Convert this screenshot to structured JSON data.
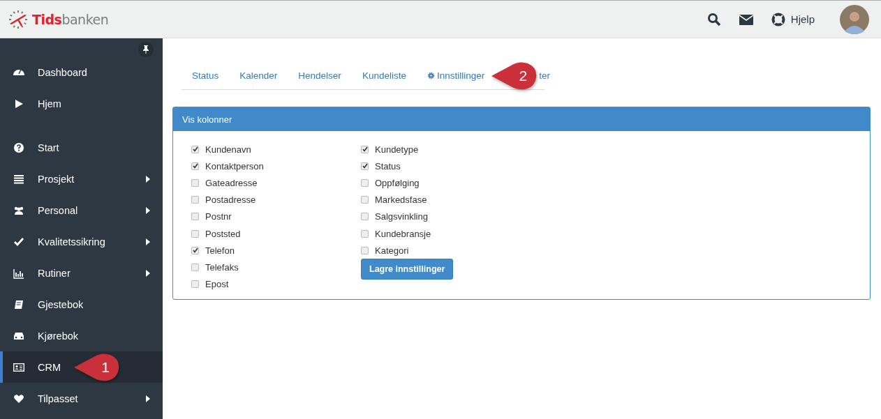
{
  "header": {
    "logo": {
      "part_1": "Tids",
      "part_2": "banken"
    },
    "help_label": "Hjelp"
  },
  "sidebar": {
    "sections": [
      {
        "items": [
          {
            "label": "Dashboard",
            "submenu": false,
            "selected": false
          },
          {
            "label": "Hjem",
            "submenu": false,
            "selected": false
          }
        ]
      },
      {
        "items": [
          {
            "label": "Start",
            "submenu": false,
            "selected": false
          },
          {
            "label": "Prosjekt",
            "submenu": true,
            "selected": false
          },
          {
            "label": "Personal",
            "submenu": true,
            "selected": false
          },
          {
            "label": "Kvalitetssikring",
            "submenu": true,
            "selected": false
          },
          {
            "label": "Rutiner",
            "submenu": true,
            "selected": false
          },
          {
            "label": "Gjestebok",
            "submenu": false,
            "selected": false
          },
          {
            "label": "Kjørebok",
            "submenu": false,
            "selected": false
          },
          {
            "label": "CRM",
            "submenu": false,
            "selected": true
          },
          {
            "label": "Tilpasset",
            "submenu": true,
            "selected": false
          }
        ]
      }
    ]
  },
  "tabs": [
    {
      "label": "Status",
      "gear": false
    },
    {
      "label": "Kalender",
      "gear": false
    },
    {
      "label": "Hendelser",
      "gear": false
    },
    {
      "label": "Kundeliste",
      "gear": false
    },
    {
      "label": "Innstillinger",
      "gear": true
    },
    {
      "label": "ter",
      "gear": false
    }
  ],
  "panel": {
    "title": "Vis kolonner",
    "columns": [
      [
        {
          "label": "Kundenavn",
          "checked": true
        },
        {
          "label": "Kontaktperson",
          "checked": true
        },
        {
          "label": "Gateadresse",
          "checked": false
        },
        {
          "label": "Postadresse",
          "checked": false
        },
        {
          "label": "Postnr",
          "checked": false
        },
        {
          "label": "Poststed",
          "checked": false
        },
        {
          "label": "Telefon",
          "checked": true
        },
        {
          "label": "Telefaks",
          "checked": false
        },
        {
          "label": "Epost",
          "checked": false
        }
      ],
      [
        {
          "label": "Kundetype",
          "checked": true
        },
        {
          "label": "Status",
          "checked": true
        },
        {
          "label": "Oppfølging",
          "checked": false
        },
        {
          "label": "Markedsfase",
          "checked": false
        },
        {
          "label": "Salgsvinkling",
          "checked": false
        },
        {
          "label": "Kundebransje",
          "checked": false
        },
        {
          "label": "Kategori",
          "checked": false
        }
      ]
    ],
    "save_button": "Lagre innstillinger"
  },
  "callouts": [
    {
      "number": "1"
    },
    {
      "number": "2"
    }
  ]
}
